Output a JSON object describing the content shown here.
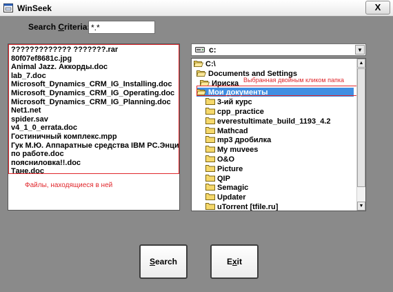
{
  "window": {
    "title": "WinSeek",
    "close_label": "X"
  },
  "search": {
    "label_prefix": "Search ",
    "label_underlined": "C",
    "label_suffix": "riteria:",
    "value": "*.*"
  },
  "files": [
    "????????????? ???????.rar",
    "80f07ef8681c.jpg",
    "Animal Jazz. Аккорды.doc",
    "lab_7.doc",
    "Microsoft_Dynamics_CRM_IG_Installing.doc",
    "Microsoft_Dynamics_CRM_IG_Operating.doc",
    "Microsoft_Dynamics_CRM_IG_Planning.doc",
    "Net1.net",
    "spider.sav",
    "v4_1_0_errata.doc",
    "Гостиничный комплекс.mpp",
    "Гук М.Ю. Аппаратные средства IBM PC.Энци",
    "по работе.doc",
    "поясниловка!!.doc",
    "Тане.doc"
  ],
  "annotations": {
    "files_note": "Файлы, находящиеся в ней",
    "selected_note": "Выбранная двойным кликом папка"
  },
  "drive": {
    "value": "c:",
    "icon": "drive-icon"
  },
  "tree": [
    {
      "label": "C:\\",
      "level": 0,
      "open": true
    },
    {
      "label": "Documents and Settings",
      "level": 1,
      "open": true
    },
    {
      "label": "Ириска",
      "level": 2,
      "open": true
    },
    {
      "label": "Мои документы",
      "level": 3,
      "open": true,
      "selected": true
    },
    {
      "label": "3-ий курс",
      "level": 4
    },
    {
      "label": "cpp_practice",
      "level": 4
    },
    {
      "label": "everestultimate_build_1193_4.2",
      "level": 4
    },
    {
      "label": "Mathcad",
      "level": 4
    },
    {
      "label": "mp3 дробилка",
      "level": 4
    },
    {
      "label": "My muvees",
      "level": 4
    },
    {
      "label": "O&O",
      "level": 4
    },
    {
      "label": "Picture",
      "level": 4
    },
    {
      "label": "QIP",
      "level": 4
    },
    {
      "label": "Semagic",
      "level": 4
    },
    {
      "label": "Updater",
      "level": 4
    },
    {
      "label": "uTorrent [tfile.ru]",
      "level": 4
    }
  ],
  "buttons": {
    "search_underlined": "S",
    "search_rest": "earch",
    "exit_prefix": "E",
    "exit_underlined": "x",
    "exit_rest": "it"
  },
  "colors": {
    "selection": "#3f8ee2",
    "annotation": "#e0262b",
    "window_bg": "#8a8a8a"
  }
}
